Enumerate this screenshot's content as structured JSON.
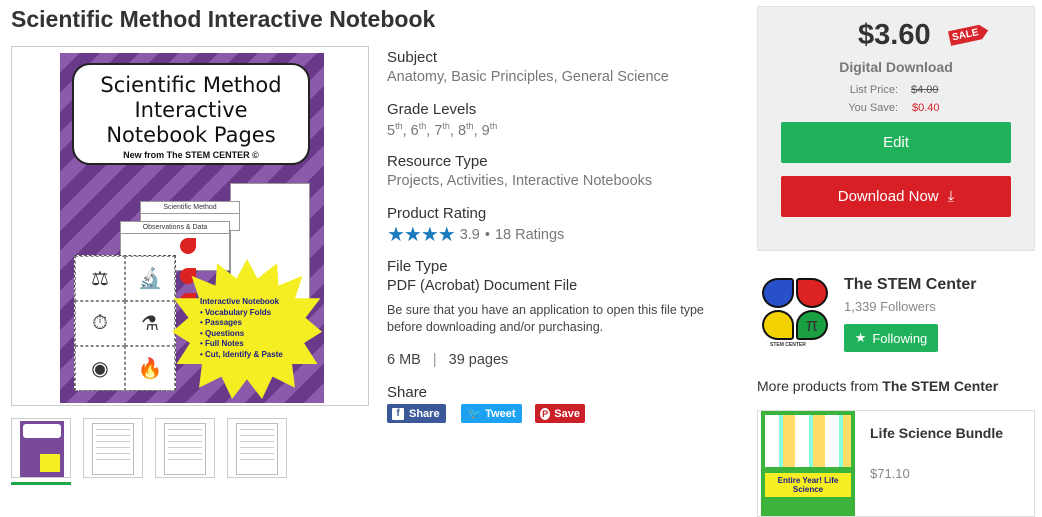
{
  "product": {
    "title": "Scientific Method Interactive Notebook",
    "cover": {
      "title_lines": [
        "Scientific Method",
        "Interactive",
        "Notebook Pages"
      ],
      "subtitle": "New from The STEM CENTER ©",
      "sheet1_header": "Scientific Method",
      "sheet2_header": "Observations & Data",
      "burst_title": "Interactive Notebook",
      "burst_items": [
        "Vocabulary Folds",
        "Passages",
        "Questions",
        "Full Notes",
        "Cut, Identify & Paste"
      ]
    }
  },
  "details": {
    "subject_label": "Subject",
    "subjects": [
      "Anatomy",
      "Basic Principles",
      "General Science"
    ],
    "grade_label": "Grade Levels",
    "grades": [
      {
        "n": "5",
        "s": "th"
      },
      {
        "n": "6",
        "s": "th"
      },
      {
        "n": "7",
        "s": "th"
      },
      {
        "n": "8",
        "s": "th"
      },
      {
        "n": "9",
        "s": "th"
      }
    ],
    "resource_label": "Resource Type",
    "resources": [
      "Projects",
      "Activities",
      "Interactive Notebooks"
    ],
    "rating_label": "Product Rating",
    "rating": 3.9,
    "rating_text": "3.9",
    "ratings_count": "18 Ratings",
    "stars": "★★★★",
    "filetype_label": "File Type",
    "filetype": "PDF (Acrobat) Document File",
    "file_note": "Be sure that you have an application to open this file type before downloading and/or purchasing.",
    "size": "6 MB",
    "pages": "39 pages",
    "share_label": "Share",
    "share_buttons": {
      "facebook": "Share",
      "twitter": "Tweet",
      "pinterest": "Save"
    }
  },
  "purchase": {
    "price": "$3.60",
    "sale_badge": "SALE",
    "type": "Digital Download",
    "list_price_label": "List Price:",
    "list_price": "$4.00",
    "you_save_label": "You Save:",
    "you_save": "$0.40",
    "edit_label": "Edit",
    "download_label": "Download Now",
    "colors": {
      "green": "#1fb25a",
      "red": "#d81f26"
    }
  },
  "seller": {
    "name": "The STEM Center",
    "followers": "1,339 Followers",
    "follow_label": "Following",
    "logo_caption": "STEM CENTER",
    "logo_symbol": "π"
  },
  "more": {
    "prefix": "More products from",
    "seller": "The STEM Center",
    "item": {
      "title": "Life Science Bundle",
      "price": "$71.10",
      "thumb_text": "Entire Year! Life Science"
    }
  }
}
